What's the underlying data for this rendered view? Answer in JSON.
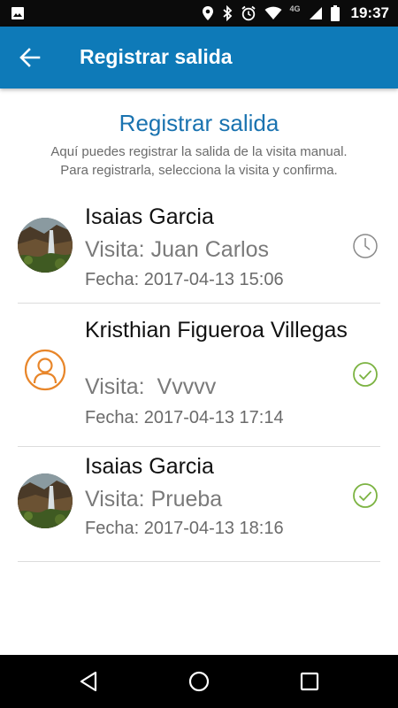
{
  "status_bar": {
    "time": "19:37",
    "network": "4G",
    "icons": [
      "image-icon",
      "location-icon",
      "bluetooth-icon",
      "alarm-icon",
      "wifi-icon",
      "signal-icon",
      "battery-icon"
    ]
  },
  "app_bar": {
    "title": "Registrar salida",
    "back_icon": "arrow-left-icon",
    "color": "#0e7ab8"
  },
  "header": {
    "title": "Registrar salida",
    "description_line1": "Aquí puedes registrar la salida de la visita manual.",
    "description_line2": "Para registrarla, selecciona la visita y confirma."
  },
  "visits": [
    {
      "name": "Isaias Garcia",
      "visit": "Visita: Juan Carlos",
      "date": "Fecha: 2017-04-13 15:06",
      "avatar": "photo",
      "status": "pending",
      "status_icon": "clock-icon"
    },
    {
      "name": "Kristhian Figueroa Villegas",
      "visit": "Visita:  Vvvvv",
      "date": "Fecha: 2017-04-13 17:14",
      "avatar": "default-person",
      "status": "checked",
      "status_icon": "check-circle-icon"
    },
    {
      "name": "Isaias Garcia",
      "visit": "Visita: Prueba",
      "date": "Fecha: 2017-04-13 18:16",
      "avatar": "photo",
      "status": "checked",
      "status_icon": "check-circle-icon"
    }
  ],
  "colors": {
    "accent": "#1a73b0",
    "check": "#7cb342",
    "person_icon": "#e8862a",
    "pending": "#8a8a8a"
  },
  "nav_bar": {
    "icons": [
      "nav-back-icon",
      "nav-home-icon",
      "nav-recent-icon"
    ]
  }
}
